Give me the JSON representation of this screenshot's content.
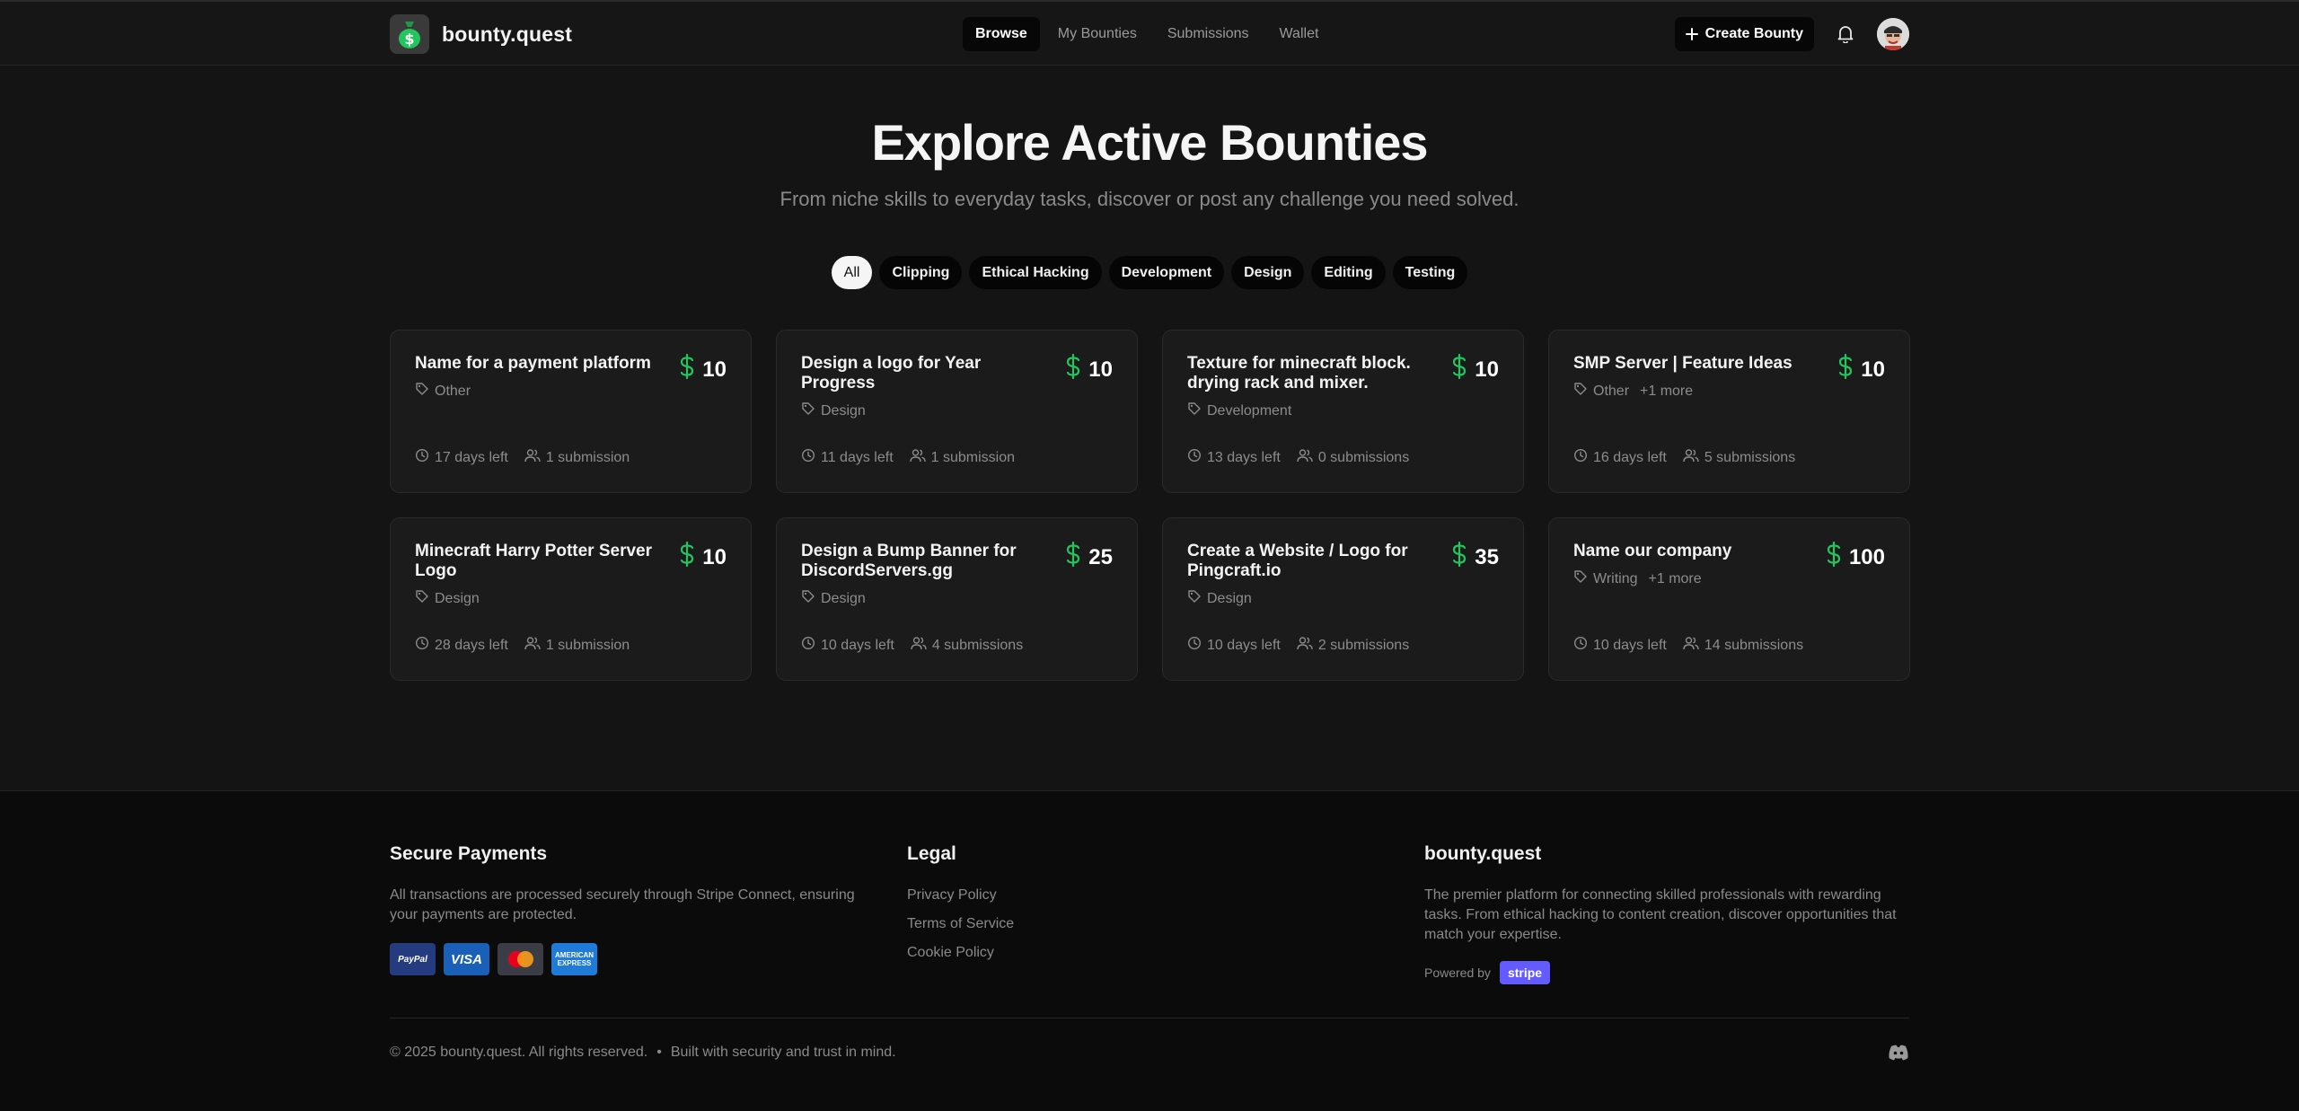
{
  "app": {
    "brand": "bounty.quest",
    "accent": "#22c55e"
  },
  "nav": {
    "items": [
      {
        "label": "Browse",
        "active": true
      },
      {
        "label": "My Bounties",
        "active": false
      },
      {
        "label": "Submissions",
        "active": false
      },
      {
        "label": "Wallet",
        "active": false
      }
    ]
  },
  "header": {
    "create_label": "Create Bounty",
    "icons": [
      "plus-icon",
      "bell-icon",
      "avatar"
    ]
  },
  "hero": {
    "title": "Explore Active Bounties",
    "subtitle": "From niche skills to everyday tasks, discover or post any challenge you need solved."
  },
  "filters": [
    {
      "label": "All",
      "active": true
    },
    {
      "label": "Clipping",
      "active": false
    },
    {
      "label": "Ethical Hacking",
      "active": false
    },
    {
      "label": "Development",
      "active": false
    },
    {
      "label": "Design",
      "active": false
    },
    {
      "label": "Editing",
      "active": false
    },
    {
      "label": "Testing",
      "active": false
    }
  ],
  "bounties": [
    {
      "title": "Name for a payment platform",
      "price": "10",
      "tag": "Other",
      "more": "",
      "time": "17 days left",
      "subs": "1 submission"
    },
    {
      "title": "Design a logo for Year Progress",
      "price": "10",
      "tag": "Design",
      "more": "",
      "time": "11 days left",
      "subs": "1 submission"
    },
    {
      "title": "Texture for minecraft block. drying rack and mixer.",
      "price": "10",
      "tag": "Development",
      "more": "",
      "time": "13 days left",
      "subs": "0 submissions"
    },
    {
      "title": "SMP Server | Feature Ideas",
      "price": "10",
      "tag": "Other",
      "more": "+1 more",
      "time": "16 days left",
      "subs": "5 submissions"
    },
    {
      "title": "Minecraft Harry Potter Server Logo",
      "price": "10",
      "tag": "Design",
      "more": "",
      "time": "28 days left",
      "subs": "1 submission"
    },
    {
      "title": "Design a Bump Banner for DiscordServers.gg",
      "price": "25",
      "tag": "Design",
      "more": "",
      "time": "10 days left",
      "subs": "4 submissions"
    },
    {
      "title": "Create a Website / Logo for Pingcraft.io",
      "price": "35",
      "tag": "Design",
      "more": "",
      "time": "10 days left",
      "subs": "2 submissions"
    },
    {
      "title": "Name our company",
      "price": "100",
      "tag": "Writing",
      "more": "+1 more",
      "time": "10 days left",
      "subs": "14 submissions"
    }
  ],
  "footer": {
    "secure": {
      "title": "Secure Payments",
      "text": "All transactions are processed securely through Stripe Connect, ensuring your payments are protected.",
      "cards": [
        "PayPal",
        "VISA",
        "mastercard",
        "AMERICAN EXPRESS"
      ]
    },
    "legal": {
      "title": "Legal",
      "links": [
        "Privacy Policy",
        "Terms of Service",
        "Cookie Policy"
      ]
    },
    "about": {
      "title": "bounty.quest",
      "text": "The premier platform for connecting skilled professionals with rewarding tasks. From ethical hacking to content creation, discover opportunities that match your expertise.",
      "powered_by": "Powered by",
      "stripe": "stripe"
    },
    "copyright": "© 2025 bounty.quest. All rights reserved.",
    "bullet": "•",
    "tagline": "Built with security and trust in mind."
  }
}
